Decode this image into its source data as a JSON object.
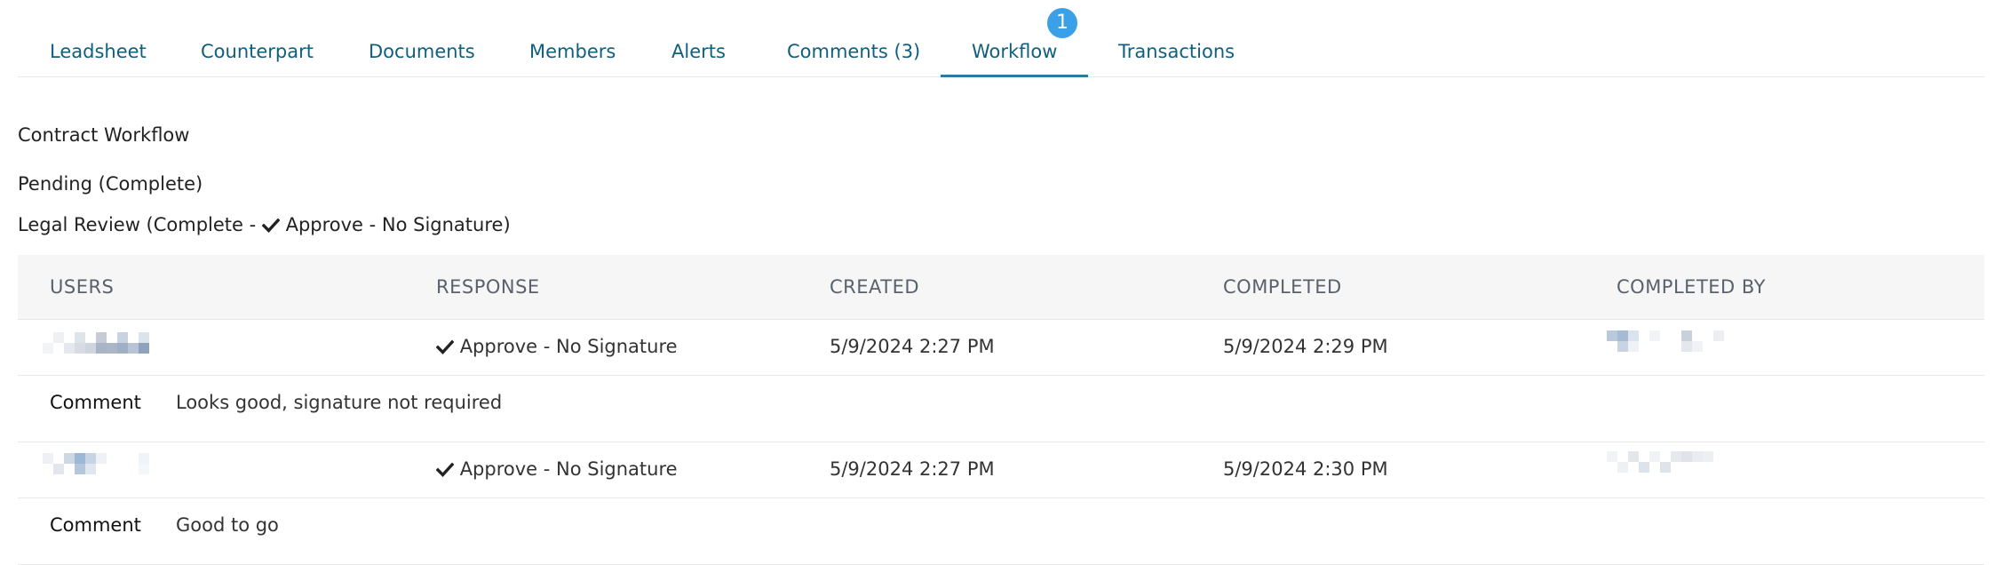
{
  "tabs": [
    {
      "label": "Leadsheet"
    },
    {
      "label": "Counterpart"
    },
    {
      "label": "Documents"
    },
    {
      "label": "Members"
    },
    {
      "label": "Alerts"
    },
    {
      "label": "Comments (3)"
    },
    {
      "label": "Workflow",
      "active": true,
      "badge": "1"
    },
    {
      "label": "Transactions"
    }
  ],
  "workflow": {
    "title": "Contract Workflow",
    "steps": [
      {
        "text": "Pending (Complete)"
      },
      {
        "prefix": "Legal Review (Complete - ",
        "icon": "check-icon",
        "suffix": "Approve - No Signature)"
      }
    ]
  },
  "table": {
    "headers": [
      "USERS",
      "RESPONSE",
      "CREATED",
      "COMPLETED",
      "COMPLETED BY"
    ],
    "rows": [
      {
        "user": "",
        "response": "Approve - No Signature",
        "created": "5/9/2024 2:27 PM",
        "completed": "5/9/2024 2:29 PM",
        "completed_by": "",
        "comment_label": "Comment",
        "comment": "Looks good, signature not required"
      },
      {
        "user": "",
        "response": "Approve - No Signature",
        "created": "5/9/2024 2:27 PM",
        "completed": "5/9/2024 2:30 PM",
        "completed_by": "",
        "comment_label": "Comment",
        "comment": "Good to go"
      }
    ]
  },
  "colors": {
    "tab_text": "#0f5f7e",
    "tab_active_underline": "#2a7aa3",
    "badge": "#3aa0e8",
    "header_bg": "#f6f6f6",
    "header_text": "#59616c"
  }
}
